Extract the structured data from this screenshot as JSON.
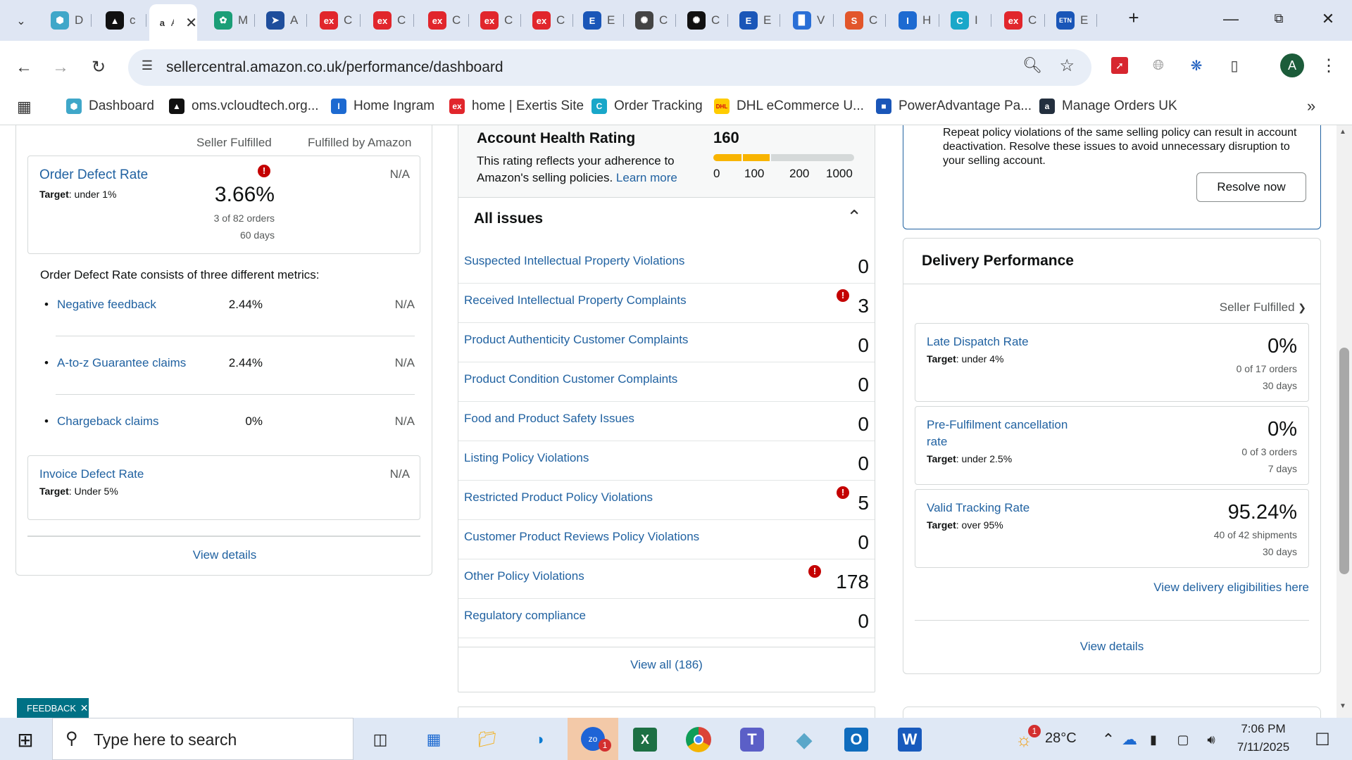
{
  "browser": {
    "tabs": [
      {
        "short": "D",
        "icon": "hex-icon",
        "color": "#3fa7c9"
      },
      {
        "short": "c",
        "icon": "triangle-logo-icon",
        "color": "#111111"
      },
      {
        "short": "A",
        "icon": "amazon-icon",
        "color": "#ffffff",
        "active": true
      },
      {
        "short": "M",
        "icon": "leaf-icon",
        "color": "#1b9e77"
      },
      {
        "short": "A",
        "icon": "play-arrow-icon",
        "color": "#1f4e9c"
      },
      {
        "short": "C",
        "icon": "exertis-icon",
        "color": "#e1262c"
      },
      {
        "short": "C",
        "icon": "exertis-icon",
        "color": "#e1262c"
      },
      {
        "short": "C",
        "icon": "exertis-icon",
        "color": "#e1262c"
      },
      {
        "short": "C",
        "icon": "exertis-icon",
        "color": "#e1262c"
      },
      {
        "short": "C",
        "icon": "exertis-icon",
        "color": "#e1262c"
      },
      {
        "short": "E",
        "icon": "e-doc-icon",
        "color": "#1a56b8"
      },
      {
        "short": "C",
        "icon": "openai-icon",
        "color": "#444444"
      },
      {
        "short": "C",
        "icon": "openai-icon",
        "color": "#111111"
      },
      {
        "short": "E",
        "icon": "e-doc-icon",
        "color": "#1a56b8"
      },
      {
        "short": "V",
        "icon": "bar-chart-icon",
        "color": "#2a6fd6"
      },
      {
        "short": "C",
        "icon": "s-logo-icon",
        "color": "#e2562b"
      },
      {
        "short": "H",
        "icon": "ingram-icon",
        "color": "#1d6ad1"
      },
      {
        "short": "I",
        "icon": "c-circle-icon",
        "color": "#19a7c9"
      },
      {
        "short": "C",
        "icon": "exertis-icon",
        "color": "#e1262c"
      },
      {
        "short": "E",
        "icon": "etn-icon",
        "color": "#1a56b8"
      }
    ],
    "url": "sellercentral.amazon.co.uk/performance/dashboard",
    "profile_initial": "A",
    "bookmarks": [
      {
        "label": "Dashboard",
        "icon": "hex-icon",
        "color": "#3fa7c9"
      },
      {
        "label": "oms.vcloudtech.org...",
        "icon": "triangle-logo-icon",
        "color": "#111111"
      },
      {
        "label": "Home Ingram",
        "icon": "ingram-icon",
        "color": "#1d6ad1"
      },
      {
        "label": "home | Exertis Site",
        "icon": "exertis-icon",
        "color": "#e1262c"
      },
      {
        "label": "Order Tracking",
        "icon": "c-circle-icon",
        "color": "#19a7c9"
      },
      {
        "label": "DHL eCommerce U...",
        "icon": "dhl-icon",
        "color": "#ffcc00"
      },
      {
        "label": "PowerAdvantage Pa...",
        "icon": "doc-icon",
        "color": "#1a56b8"
      },
      {
        "label": "Manage Orders UK",
        "icon": "amazon-icon",
        "color": "#232f3e"
      }
    ]
  },
  "customer_service": {
    "col_seller": "Seller Fulfilled",
    "col_fba": "Fulfilled by Amazon",
    "odr": {
      "title": "Order Defect Rate",
      "target_label": "Target",
      "target_value": ": under 1%",
      "value": "3.66%",
      "orders": "3 of 82 orders",
      "days": "60 days",
      "fba": "N/A"
    },
    "consists_text": "Order Defect Rate consists of three different metrics:",
    "metrics": [
      {
        "name": "Negative feedback",
        "value": "2.44%",
        "fba": "N/A"
      },
      {
        "name": "A-to-z Guarantee claims",
        "value": "2.44%",
        "fba": "N/A"
      },
      {
        "name": "Chargeback claims",
        "value": "0%",
        "fba": "N/A"
      }
    ],
    "idr": {
      "title": "Invoice Defect Rate",
      "target_label": "Target",
      "target_value": ": Under 5%",
      "fba": "N/A"
    },
    "view_details": "View details"
  },
  "account_health": {
    "title": "Account Health Rating",
    "score": "160",
    "desc": "This rating reflects your adherence to Amazon's selling policies.",
    "learn_more": "Learn more",
    "scale": [
      "0",
      "100",
      "200",
      "1000"
    ],
    "all_issues": "All issues",
    "issues": [
      {
        "label": "Suspected Intellectual Property Violations",
        "count": "0",
        "alert": false
      },
      {
        "label": "Received Intellectual Property Complaints",
        "count": "3",
        "alert": true
      },
      {
        "label": "Product Authenticity Customer Complaints",
        "count": "0",
        "alert": false
      },
      {
        "label": "Product Condition Customer Complaints",
        "count": "0",
        "alert": false
      },
      {
        "label": "Food and Product Safety Issues",
        "count": "0",
        "alert": false
      },
      {
        "label": "Listing Policy Violations",
        "count": "0",
        "alert": false
      },
      {
        "label": "Restricted Product Policy Violations",
        "count": "5",
        "alert": true
      },
      {
        "label": "Customer Product Reviews Policy Violations",
        "count": "0",
        "alert": false
      },
      {
        "label": "Other Policy Violations",
        "count": "178",
        "alert": true
      },
      {
        "label": "Regulatory compliance",
        "count": "0",
        "alert": false
      }
    ],
    "view_all": "View all (186)"
  },
  "notice": {
    "text": "Repeat policy violations of the same selling policy can result in account deactivation. Resolve these issues to avoid unnecessary disruption to your selling account.",
    "resolve": "Resolve now"
  },
  "delivery": {
    "title": "Delivery Performance",
    "filter": "Seller Fulfilled",
    "metrics": [
      {
        "name": "Late Dispatch Rate",
        "target_label": "Target",
        "target_value": ": under 4%",
        "value": "0%",
        "detail": "0 of 17 orders",
        "days": "30 days"
      },
      {
        "name": "Pre-Fulfilment cancellation rate",
        "target_label": "Target",
        "target_value": ": under 2.5%",
        "value": "0%",
        "detail": "0 of 3 orders",
        "days": "7 days"
      },
      {
        "name": "Valid Tracking Rate",
        "target_label": "Target",
        "target_value": ": over 95%",
        "value": "95.24%",
        "detail": "40 of 42 shipments",
        "days": "30 days"
      }
    ],
    "eligibilities": "View delivery eligibilities here",
    "view_details": "View details"
  },
  "feedback": "FEEDBACK",
  "taskbar": {
    "search_placeholder": "Type here to search",
    "temp": "28°C",
    "weather_badge": "1",
    "zoom_badge": "1",
    "time": "7:06 PM",
    "date": "7/11/2025"
  }
}
